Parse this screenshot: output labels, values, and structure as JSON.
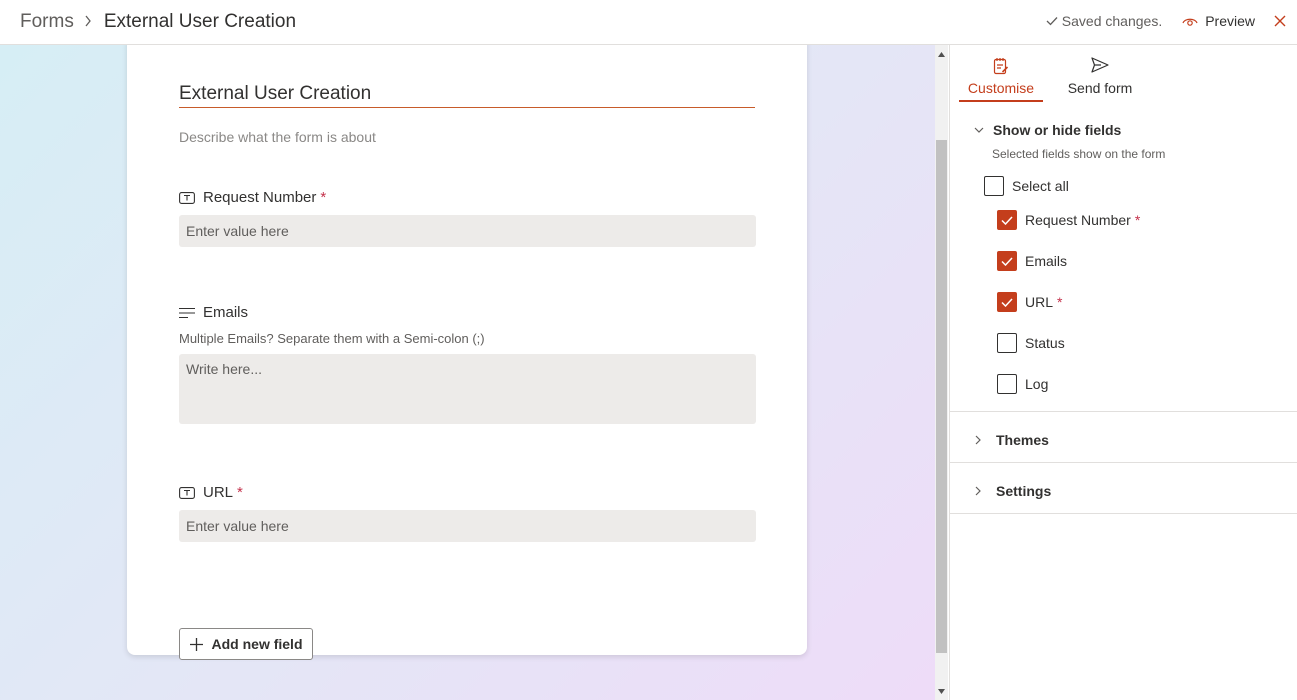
{
  "header": {
    "breadcrumb_root": "Forms",
    "breadcrumb_current": "External User Creation",
    "saved_status": "Saved changes.",
    "preview_label": "Preview"
  },
  "form": {
    "title": "External User Creation",
    "description_placeholder": "Describe what the form is about",
    "questions": [
      {
        "label": "Request Number",
        "required": "*",
        "placeholder": "Enter value here"
      },
      {
        "label": "Emails",
        "subtitle": "Multiple Emails? Separate them with a Semi-colon (;)",
        "placeholder": "Write here..."
      },
      {
        "label": "URL",
        "required": "*",
        "placeholder": "Enter value here"
      }
    ],
    "add_field_label": "Add new field"
  },
  "panel": {
    "tabs": [
      {
        "label": "Customise",
        "active": true
      },
      {
        "label": "Send form",
        "active": false
      }
    ],
    "show_hide": {
      "title": "Show or hide fields",
      "description": "Selected fields show on the form",
      "select_all": "Select all",
      "fields": [
        {
          "label": "Request Number",
          "required": "*",
          "checked": true
        },
        {
          "label": "Emails",
          "checked": true
        },
        {
          "label": "URL",
          "required": "*",
          "checked": true
        },
        {
          "label": "Status",
          "checked": false
        },
        {
          "label": "Log",
          "checked": false
        }
      ]
    },
    "themes_label": "Themes",
    "settings_label": "Settings"
  },
  "colors": {
    "accent": "#c43e1c",
    "required": "#c4314b",
    "input_bg": "#edebe9"
  }
}
